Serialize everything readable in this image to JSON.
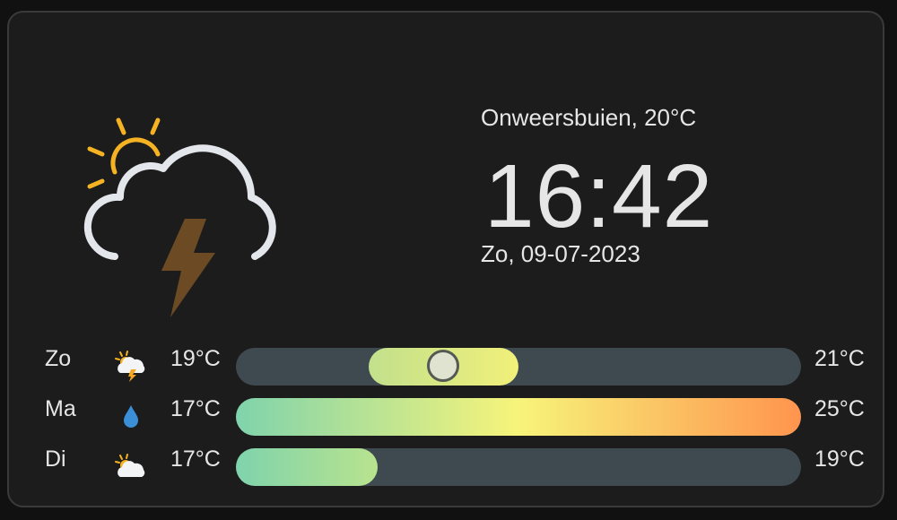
{
  "current": {
    "icon": "thunderstorm-partly-sunny-icon",
    "condition": "Onweersbuien, 20°C",
    "time": "16:42",
    "date": "Zo, 09-07-2023"
  },
  "forecast": [
    {
      "day": "Zo",
      "icon": "partly-sunny-thunder-icon",
      "low": "19°C",
      "high": "21°C",
      "range_fraction": [
        0.235,
        0.5
      ],
      "current_fraction": 0.366,
      "gradient": [
        "#c2e08c",
        "#f1f07a"
      ]
    },
    {
      "day": "Ma",
      "icon": "raindrop-icon",
      "low": "17°C",
      "high": "25°C",
      "range_fraction": [
        0.0,
        1.0
      ],
      "gradient": [
        "#7fd3ac",
        "#f7f47a",
        "#ff944e"
      ]
    },
    {
      "day": "Di",
      "icon": "partly-cloudy-icon",
      "low": "17°C",
      "high": "19°C",
      "range_fraction": [
        0.0,
        0.25
      ],
      "gradient": [
        "#7fd3ac",
        "#b8e38e"
      ]
    }
  ],
  "colors": {
    "background": "#1c1c1c",
    "track": "#3f4a50",
    "sun": "#f5b324",
    "bolt": "#6b4a24",
    "cloud_stroke": "#e3e6ea"
  }
}
